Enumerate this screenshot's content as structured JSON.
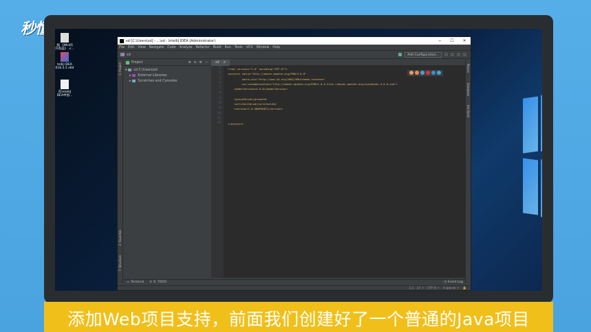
{
  "branding": {
    "logo_text": "秒懂视频"
  },
  "desktop": {
    "icons": [
      {
        "label": "加 《Win问\n只有这》 -c..."
      },
      {
        "label": "telliJ IDEA\n018.3.5 x64"
      },
      {
        "label": "在IntelliJ\nDEA中创..."
      }
    ]
  },
  "ide": {
    "window_title": "sd [C:\\Users\\sd] - ...\\sd - IntelliJ IDEA (Administrator)",
    "window_controls": [
      "−",
      "☐",
      "✕"
    ],
    "menu": [
      "File",
      "Edit",
      "View",
      "Navigate",
      "Code",
      "Analyze",
      "Refactor",
      "Build",
      "Run",
      "Tools",
      "VCS",
      "Window",
      "Help"
    ],
    "breadcrumb": "sd",
    "add_configuration": "Add Configuration...",
    "left_tabs": [
      "1: Project",
      "2: Favorites",
      "7: Structure"
    ],
    "right_tabs": [
      "Maven",
      "Database",
      "Ant Build"
    ],
    "project_panel": {
      "title": "Project",
      "tree": [
        {
          "label": "sd  C:\\Users\\sd"
        },
        {
          "label": "External Libraries"
        },
        {
          "label": "Scratches and Consoles"
        }
      ]
    },
    "editor_tab": "sd",
    "line_numbers": [
      "1",
      "2",
      "3",
      "4",
      "5",
      "6",
      "7",
      "8",
      "9",
      "10",
      "11",
      "12"
    ],
    "code_lines": [
      "<?xml version=\"1.0\" encoding=\"UTF-8\"?>",
      "<project xmlns=\"http://maven.apache.org/POM/4.0.0\"",
      "         xmlns:xsi=\"http://www.w3.org/2001/XMLSchema-instance\"",
      "         xsi:schemaLocation=\"http://maven.apache.org/POM/4.0.0 http://maven.apache.org/xsd/maven-4.0.0.xsd\">",
      "    <modelVersion>4.0.0</modelVersion>",
      "",
      "    <groupId>sd</groupId>",
      "    <artifactId>sd</artifactId>",
      "    <version>1.0-SNAPSHOT</version>",
      "",
      "",
      "</project>"
    ],
    "bottom_tools": {
      "terminal": "Terminal",
      "todo": "6: TODO",
      "event_log": "Event Log"
    },
    "status": {
      "position": "1:1",
      "line_sep": "LF ÷",
      "encoding": "UTF-8 ÷",
      "indent": "4 spaces ÷"
    }
  },
  "caption": {
    "text": "添加Web项目支持，前面我们创建好了一个普通的Java项目"
  }
}
